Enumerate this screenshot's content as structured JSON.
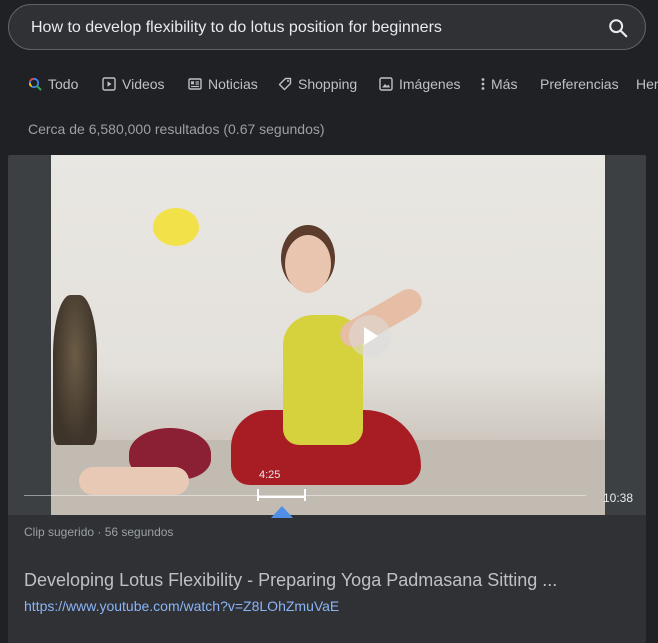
{
  "search": {
    "query": "How to develop flexibility to do lotus position for beginners"
  },
  "tabs": [
    {
      "label": "Todo",
      "icon": "search-icon"
    },
    {
      "label": "Videos",
      "icon": "video-icon"
    },
    {
      "label": "Noticias",
      "icon": "news-icon"
    },
    {
      "label": "Shopping",
      "icon": "tag-icon"
    },
    {
      "label": "Imágenes",
      "icon": "image-icon"
    },
    {
      "label": "Más",
      "icon": "more-vertical-icon"
    },
    {
      "label": "Preferencias"
    },
    {
      "label": "Her"
    }
  ],
  "results": {
    "count_text": "Cerca de 6,580,000 resultados (0.67 segundos)"
  },
  "video": {
    "clip_start_time": "4:25",
    "duration": "10:38",
    "clip_label": "Clip sugerido · 56 segundos",
    "title": "Developing Lotus Flexibility - Preparing Yoga Padmasana Sitting ...",
    "url": "https://www.youtube.com/watch?v=Z8LOhZmuVaE"
  },
  "colors": {
    "background": "#202124",
    "link": "#8ab4f8",
    "marker": "#4f8fe8"
  }
}
